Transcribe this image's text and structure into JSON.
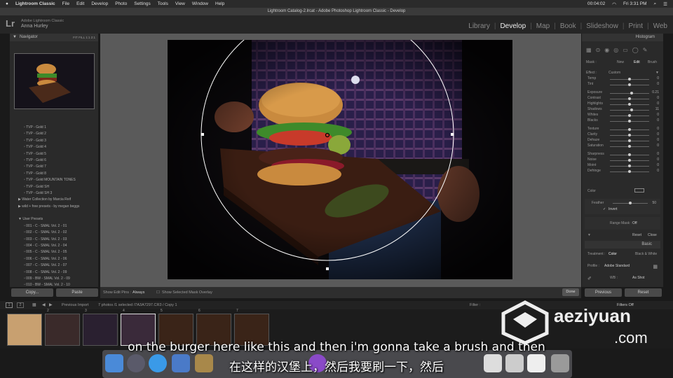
{
  "menubar": {
    "app": "Lightroom Classic",
    "items": [
      "File",
      "Edit",
      "Develop",
      "Photo",
      "Settings",
      "Tools",
      "View",
      "Window",
      "Help"
    ],
    "time_elapsed": "00:04:02",
    "clock": "Fri 3:31 PM"
  },
  "window": {
    "title": "Lightroom Catalog-2.lrcat - Adobe Photoshop Lightroom Classic - Develop"
  },
  "brand": {
    "logo": "Lr",
    "line1": "Adobe Lightroom Classic",
    "line2": "Anna Hurley"
  },
  "modules": [
    "Library",
    "Develop",
    "Map",
    "Book",
    "Slideshow",
    "Print",
    "Web"
  ],
  "navigator": {
    "title": "Navigator",
    "zoom": [
      "FIT",
      "FILL",
      "1:1",
      "2:1"
    ]
  },
  "presets": [
    "TVP - Gold 1",
    "TVP - Gold 2",
    "TVP - Gold 3",
    "TVP - Gold 4",
    "TVP - Gold 5",
    "TVP - Gold 6",
    "TVP - Gold 7",
    "TVP - Gold 8",
    "TVP - Gold MOUNTAIN TONES",
    "TVP - Gold SH",
    "TVP - Gold SH 3",
    "Water Collection by Marcia Reif",
    "wild + free presets - by megan beggs",
    "",
    "User Presets",
    "001 - C - SMAL Vol. 2 - 01",
    "002 - C - SMAL Vol. 2 - 02",
    "003 - C - SMAL Vol. 2 - 03",
    "004 - C - SMAL Vol. 2 - 04",
    "005 - C - SMAL Vol. 2 - 05",
    "006 - C - SMAL Vol. 2 - 06",
    "007 - C - SMAL Vol. 2 - 07",
    "008 - C - SMAL Vol. 2 - 09",
    "009 - BW - SMAL Vol. 2 - 09",
    "010 - BW - SMAL Vol. 2 - 10"
  ],
  "left_buttons": {
    "copy": "Copy...",
    "paste": "Paste"
  },
  "toolbar": {
    "show_edit_pins": "Show Edit Pins :",
    "pins_value": "Always",
    "show_mask": "Show Selected Mask Overlay",
    "done": "Done"
  },
  "histogram": {
    "title": "Histogram"
  },
  "mask": {
    "label": "Mask :",
    "new": "New",
    "edit": "Edit",
    "brush": "Brush",
    "effect": "Effect :",
    "effect_value": "Custom"
  },
  "sliders": [
    {
      "label": "Temp",
      "value": "0",
      "pos": 0.5
    },
    {
      "label": "Tint",
      "value": "0",
      "pos": 0.5
    },
    {
      "label": "Exposure",
      "value": "0.21",
      "pos": 0.55
    },
    {
      "label": "Contrast",
      "value": "0",
      "pos": 0.5
    },
    {
      "label": "Highlights",
      "value": "0",
      "pos": 0.5
    },
    {
      "label": "Shadows",
      "value": "11",
      "pos": 0.56
    },
    {
      "label": "Whites",
      "value": "0",
      "pos": 0.5
    },
    {
      "label": "Blacks",
      "value": "0",
      "pos": 0.5
    },
    {
      "label": "Texture",
      "value": "0",
      "pos": 0.5
    },
    {
      "label": "Clarity",
      "value": "0",
      "pos": 0.5
    },
    {
      "label": "Dehaze",
      "value": "0",
      "pos": 0.5
    },
    {
      "label": "Saturation",
      "value": "0",
      "pos": 0.5
    },
    {
      "label": "Sharpness",
      "value": "0",
      "pos": 0.5
    },
    {
      "label": "Noise",
      "value": "0",
      "pos": 0.5
    },
    {
      "label": "Moiré",
      "value": "0",
      "pos": 0.5
    },
    {
      "label": "Defringe",
      "value": "0",
      "pos": 0.5
    }
  ],
  "color_label": "Color",
  "feather": {
    "label": "Feather",
    "value": "50",
    "pos": 0.5,
    "invert": "Invert"
  },
  "range_mask": {
    "label": "Range Mask :",
    "value": "Off"
  },
  "mask_buttons": {
    "reset": "Reset",
    "close": "Close"
  },
  "basic": {
    "title": "Basic",
    "treatment": "Treatment :",
    "color": "Color",
    "bw": "Black & White",
    "profile": "Profile :",
    "profile_value": "Adobe Standard",
    "wb": "WB :",
    "wb_value": "As Shot"
  },
  "right_buttons": {
    "previous": "Previous",
    "reset": "Reset"
  },
  "filmbar": {
    "source": "Previous Import",
    "info": "7 photos /1 selected /7A3A7297.CR3 / Copy 1",
    "filter": "Filter :",
    "filter_value": "Filters Off"
  },
  "film_numbers": [
    "",
    "2",
    "3",
    "4",
    "5",
    "6",
    "7"
  ],
  "subtitles": {
    "en": "on the burger here like this and then i'm gonna take a brush and then",
    "zh": "在这样的汉堡上，然后我要刷一下，然后"
  },
  "watermark": {
    "name": "aeziyuan",
    "domain": ".com"
  }
}
